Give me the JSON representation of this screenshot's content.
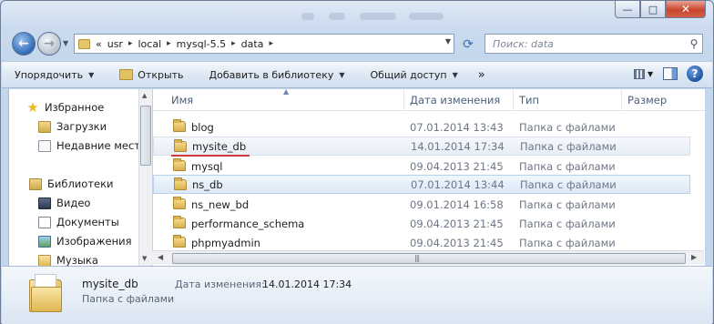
{
  "window": {
    "controls": {
      "minimize": "—",
      "maximize": "□",
      "close": "✕"
    }
  },
  "nav": {
    "back_glyph": "←",
    "forward_glyph": "→"
  },
  "address": {
    "prefix": "«",
    "crumbs": [
      "usr",
      "local",
      "mysql-5.5",
      "data"
    ]
  },
  "search": {
    "placeholder": "Поиск: data"
  },
  "toolbar": {
    "organize": "Упорядочить",
    "open": "Открыть",
    "add_to_library": "Добавить в библиотеку",
    "share": "Общий доступ",
    "more": "»"
  },
  "sidebar": {
    "favorites": "Избранное",
    "downloads": "Загрузки",
    "recent": "Недавние места",
    "libraries": "Библиотеки",
    "video": "Видео",
    "documents": "Документы",
    "images": "Изображения",
    "music": "Музыка"
  },
  "columns": {
    "name": "Имя",
    "date": "Дата изменения",
    "type": "Тип",
    "size": "Размер"
  },
  "files": [
    {
      "name": "blog",
      "date": "07.01.2014 13:43",
      "type": "Папка с файлами"
    },
    {
      "name": "mysite_db",
      "date": "14.01.2014 17:34",
      "type": "Папка с файлами"
    },
    {
      "name": "mysql",
      "date": "09.04.2013 21:45",
      "type": "Папка с файлами"
    },
    {
      "name": "ns_db",
      "date": "07.01.2014 13:44",
      "type": "Папка с файлами"
    },
    {
      "name": "ns_new_bd",
      "date": "09.01.2014 16:58",
      "type": "Папка с файлами"
    },
    {
      "name": "performance_schema",
      "date": "09.04.2013 21:45",
      "type": "Папка с файлами"
    },
    {
      "name": "phpmyadmin",
      "date": "09.04.2013 21:45",
      "type": "Папка с файлами"
    }
  ],
  "details": {
    "name": "mysite_db",
    "type": "Папка с файлами",
    "date_label": "Дата изменения:",
    "date_value": "14.01.2014 17:34"
  }
}
